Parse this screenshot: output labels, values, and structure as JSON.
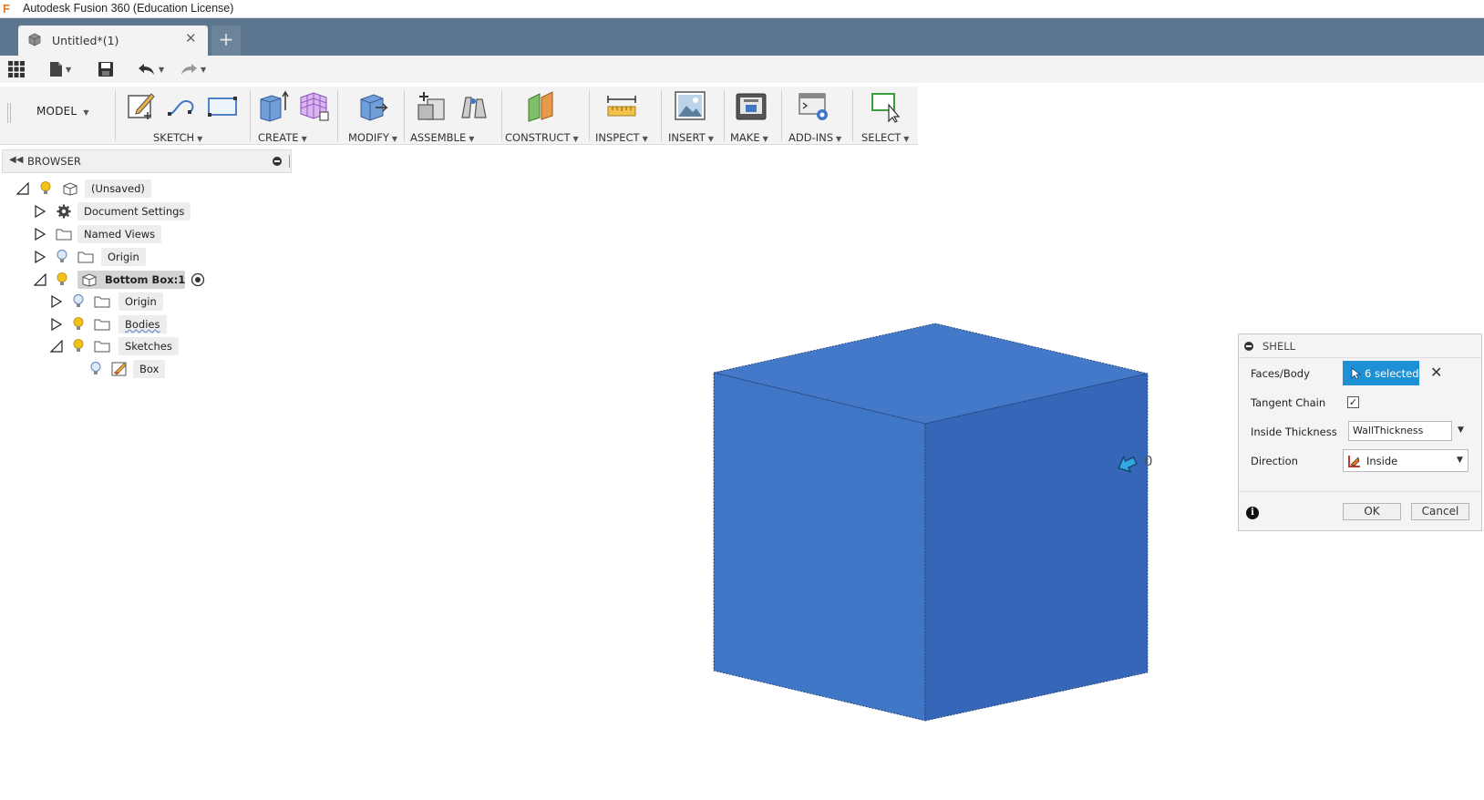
{
  "window": {
    "title": "Autodesk Fusion 360 (Education License)",
    "logo": "F"
  },
  "tabs": [
    {
      "label": "Untitled*(1)"
    }
  ],
  "new_tab_label": "+",
  "workspace": {
    "label": "MODEL"
  },
  "ribbon": {
    "groups": [
      {
        "label": "SKETCH"
      },
      {
        "label": "CREATE"
      },
      {
        "label": "MODIFY"
      },
      {
        "label": "ASSEMBLE"
      },
      {
        "label": "CONSTRUCT"
      },
      {
        "label": "INSPECT"
      },
      {
        "label": "INSERT"
      },
      {
        "label": "MAKE"
      },
      {
        "label": "ADD-INS"
      },
      {
        "label": "SELECT"
      }
    ]
  },
  "browser": {
    "title": "BROWSER",
    "nodes": [
      {
        "label": "(Unsaved)"
      },
      {
        "label": "Document Settings"
      },
      {
        "label": "Named Views"
      },
      {
        "label": "Origin"
      },
      {
        "label": "Bottom Box:1"
      },
      {
        "label": "Origin"
      },
      {
        "label": "Bodies"
      },
      {
        "label": "Sketches"
      },
      {
        "label": "Box"
      }
    ]
  },
  "shell_dialog": {
    "title": "SHELL",
    "faces_label": "Faces/Body",
    "faces_value": "6 selected",
    "tangent_label": "Tangent Chain",
    "tangent_checked": true,
    "thickness_label": "Inside Thickness",
    "thickness_value": "WallThickness",
    "direction_label": "Direction",
    "direction_value": "Inside",
    "ok_label": "OK",
    "cancel_label": "Cancel"
  },
  "viewport": {
    "dimension_label": "0",
    "body_color": "#3f76c6"
  },
  "colors": {
    "tab_strip": "#5b768e",
    "accent": "#1e90d6",
    "logo": "#e8761b"
  }
}
